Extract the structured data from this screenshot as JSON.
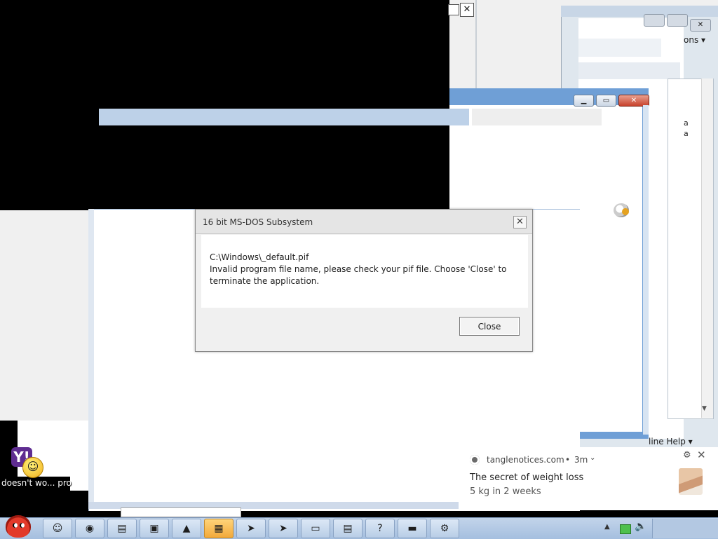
{
  "background": {
    "options_fragment": "ons",
    "help_fragment": "line Help",
    "side_chars": [
      "a",
      "a"
    ]
  },
  "desktop": {
    "icon_label": "doesn't wo...",
    "icon_label2": "pro"
  },
  "dialog": {
    "title": "16 bit MS-DOS Subsystem",
    "close_glyph": "✕",
    "message_lines": [
      "C:\\Windows\\_default.pif",
      "Invalid program file name, please check your pif file. Choose 'Close' to",
      "terminate the application."
    ],
    "close_button": "Close"
  },
  "notification": {
    "site": "tanglenotices.com",
    "separator": "•",
    "time": "3m",
    "title": "The secret of weight loss",
    "body": "5 kg in 2 weeks"
  },
  "taskbar": {
    "apps": [
      {
        "name": "yahoo-messenger",
        "glyph": "☺"
      },
      {
        "name": "chrome",
        "glyph": "◉"
      },
      {
        "name": "notepad",
        "glyph": "▤"
      },
      {
        "name": "installer",
        "glyph": "▣"
      },
      {
        "name": "vlc",
        "glyph": "▲"
      },
      {
        "name": "image-viewer",
        "glyph": "▦"
      },
      {
        "name": "teamviewer-1",
        "glyph": "➤"
      },
      {
        "name": "teamviewer-2",
        "glyph": "➤"
      },
      {
        "name": "window-app",
        "glyph": "▭"
      },
      {
        "name": "document-app",
        "glyph": "▤"
      },
      {
        "name": "help",
        "glyph": "?"
      },
      {
        "name": "terminal",
        "glyph": "▬"
      },
      {
        "name": "settings-app",
        "glyph": "⚙"
      }
    ],
    "active_index": 5
  }
}
